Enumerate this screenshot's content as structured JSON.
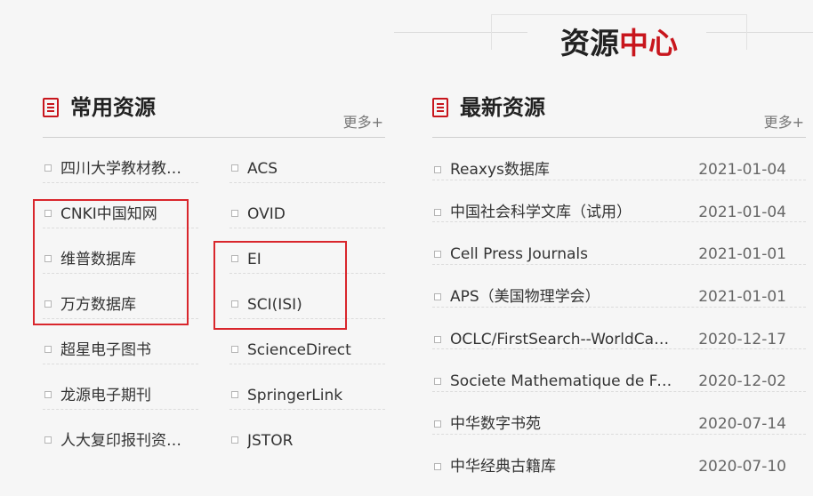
{
  "header": {
    "title_dark": "资源",
    "title_red": "中心"
  },
  "common": {
    "title": "常用资源",
    "more": "更多+",
    "col1": [
      {
        "label": "四川大学教材教参..."
      },
      {
        "label": "CNKI中国知网"
      },
      {
        "label": "维普数据库"
      },
      {
        "label": "万方数据库"
      },
      {
        "label": "超星电子图书"
      },
      {
        "label": "龙源电子期刊"
      },
      {
        "label": "人大复印报刊资料..."
      }
    ],
    "col2": [
      {
        "label": "ACS"
      },
      {
        "label": "OVID"
      },
      {
        "label": "EI"
      },
      {
        "label": "SCI(ISI)"
      },
      {
        "label": "ScienceDirect"
      },
      {
        "label": "SpringerLink"
      },
      {
        "label": "JSTOR"
      }
    ]
  },
  "latest": {
    "title": "最新资源",
    "more": "更多+",
    "items": [
      {
        "label": "Reaxys数据库",
        "date": "2021-01-04"
      },
      {
        "label": "中国社会科学文库（试用）",
        "date": "2021-01-04"
      },
      {
        "label": "Cell Press Journals",
        "date": "2021-01-01"
      },
      {
        "label": "APS（美国物理学会）",
        "date": "2021-01-01"
      },
      {
        "label": "OCLC/FirstSearch--WorldCat...",
        "date": "2020-12-17"
      },
      {
        "label": "Societe Mathematique de Fr...",
        "date": "2020-12-02"
      },
      {
        "label": "中华数字书苑",
        "date": "2020-07-14"
      },
      {
        "label": "中华经典古籍库",
        "date": "2020-07-10"
      }
    ]
  },
  "colors": {
    "accent": "#c8161d",
    "highlight": "#d9262c"
  }
}
